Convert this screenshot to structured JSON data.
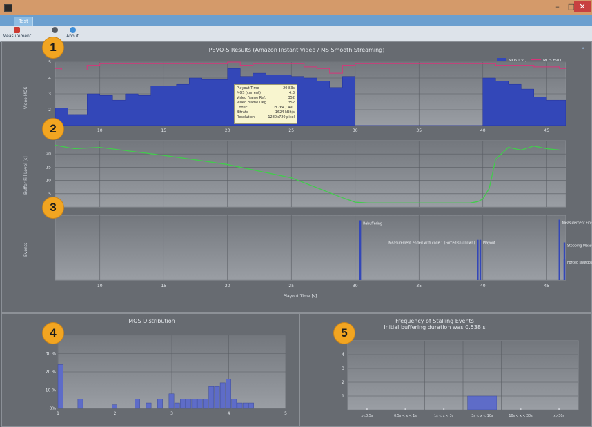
{
  "window": {
    "title": "",
    "min": "–",
    "max": "□",
    "close": "✕"
  },
  "ribbon": {
    "active_tab": "Test",
    "buttons": [
      {
        "label": "Measurement",
        "icon": "measurement-icon",
        "color": "#cc3b33"
      },
      {
        "label": "",
        "icon": "camera-icon",
        "color": "#555b63"
      },
      {
        "label": "About",
        "icon": "info-icon",
        "color": "#3f8fd8"
      }
    ]
  },
  "panel_title": "PEVQ-S Results (Amazon Instant Video / MS Smooth Streaming)",
  "badges": [
    "1",
    "2",
    "3",
    "4",
    "5"
  ],
  "colors": {
    "mos_cvq": "#3347b8",
    "mos_bvq": "#d8347a",
    "buffer": "#42cc4c",
    "event": "#3347b8",
    "hist": "#5e6cc8"
  },
  "chart_data": [
    {
      "type": "area",
      "ylabel": "Video MOS",
      "ylim": [
        1,
        5
      ],
      "yticks": [
        "2",
        "3",
        "4",
        "5"
      ],
      "xlim": [
        6.5,
        46.5
      ],
      "xticks": [
        "10",
        "15",
        "20",
        "25",
        "30",
        "35",
        "40",
        "45"
      ],
      "legend": [
        "MOS CVQ",
        "MOS BVQ"
      ],
      "legend_position": "top-right",
      "series": [
        {
          "name": "MOS CVQ",
          "x": [
            6.5,
            7,
            7.5,
            8,
            9,
            10,
            11,
            12,
            13,
            14,
            15,
            16,
            17,
            18,
            19,
            20,
            21,
            22,
            23,
            24,
            25,
            26,
            27,
            28,
            29,
            30,
            31,
            39,
            39.5,
            40,
            41,
            42,
            43,
            44,
            45,
            46
          ],
          "values": [
            2.1,
            2.1,
            1.7,
            1.7,
            3.0,
            2.9,
            2.6,
            3.0,
            2.9,
            3.5,
            3.5,
            3.6,
            4.0,
            3.9,
            3.9,
            4.6,
            4.1,
            4.3,
            4.2,
            4.2,
            4.1,
            4.0,
            3.8,
            3.4,
            4.1,
            1.0,
            1.0,
            1.0,
            1.0,
            4.0,
            3.8,
            3.6,
            3.3,
            2.8,
            2.6,
            2.6
          ]
        },
        {
          "name": "MOS BVQ",
          "x": [
            6.5,
            7,
            8,
            9,
            10,
            15,
            20,
            21,
            22,
            25,
            26,
            27,
            28,
            29,
            30,
            31,
            35,
            39,
            40,
            41,
            42,
            43,
            44,
            45,
            46
          ],
          "values": [
            4.6,
            4.5,
            4.5,
            4.8,
            4.9,
            4.9,
            5.0,
            4.8,
            4.9,
            4.9,
            4.7,
            4.6,
            4.3,
            4.8,
            4.9,
            4.9,
            4.9,
            4.9,
            4.9,
            4.8,
            4.8,
            4.8,
            4.7,
            4.7,
            4.6
          ]
        }
      ],
      "tooltip": [
        [
          "Playout Time",
          "20.83s"
        ],
        [
          "MOS (current)",
          "4.3"
        ],
        [
          "Video Frame Ref.",
          "352"
        ],
        [
          "Video Frame Deg.",
          "352"
        ],
        [
          "Codec",
          "H.264 / AVC"
        ],
        [
          "Bitrate",
          "1624 kBit/s"
        ],
        [
          "Resolution",
          "1280x720 pixel"
        ]
      ]
    },
    {
      "type": "line",
      "ylabel": "Buffer Fill Level [s]",
      "ylim": [
        0,
        25
      ],
      "yticks": [
        "5",
        "10",
        "15",
        "20"
      ],
      "xlim": [
        6.5,
        46.5
      ],
      "series": [
        {
          "name": "",
          "x": [
            6.5,
            8,
            10,
            15,
            20,
            25,
            29,
            30,
            31,
            35,
            38,
            39,
            39.6,
            40,
            40.5,
            41,
            42,
            43,
            44,
            45,
            46
          ],
          "values": [
            23.3,
            22.0,
            22.5,
            19.5,
            16.0,
            11.0,
            3.5,
            1.8,
            1.5,
            1.5,
            1.5,
            1.5,
            2.0,
            3.0,
            7.0,
            18.0,
            22.5,
            21.5,
            23.0,
            22.0,
            21.5
          ]
        }
      ]
    },
    {
      "type": "events",
      "ylabel": "Events",
      "xlabel": "Playout Time [s]",
      "xlim": [
        6.5,
        46.5
      ],
      "xticks": [
        "10",
        "15",
        "20",
        "25",
        "30",
        "35",
        "40",
        "45"
      ],
      "events": [
        {
          "x": 30.4,
          "label": "Rebuffering",
          "height": 0.92
        },
        {
          "x": 39.6,
          "label": "Measurement ended with code 1 (Forced shutdown)",
          "height": 0.62
        },
        {
          "x": 39.8,
          "label": "Playout",
          "height": 0.62
        },
        {
          "x": 46.0,
          "label": "Measurement Finished",
          "height": 0.93
        },
        {
          "x": 46.5,
          "label": "Stopping Measurement",
          "height": 0.58
        },
        {
          "x": 46.8,
          "label": "Forced shutdown",
          "height": 0.32
        }
      ]
    },
    {
      "type": "bar",
      "title": "MOS Distribution",
      "ylim": [
        0,
        40
      ],
      "yticks": [
        "0%",
        "10 %",
        "20 %",
        "30 %",
        "40 %"
      ],
      "xlim": [
        1,
        5
      ],
      "xticks": [
        "1",
        "2",
        "3",
        "4",
        "5"
      ],
      "bin_width": 0.1,
      "x": [
        1.05,
        1.4,
        2.0,
        2.4,
        2.6,
        2.8,
        3.0,
        3.1,
        3.2,
        3.3,
        3.4,
        3.5,
        3.6,
        3.7,
        3.8,
        3.9,
        4.0,
        4.1,
        4.2,
        4.3,
        4.4
      ],
      "values": [
        24,
        5,
        2,
        5,
        3,
        5,
        8,
        3,
        5,
        5,
        5,
        5,
        5,
        12,
        12,
        14,
        16,
        5,
        3,
        3,
        3
      ]
    },
    {
      "type": "bar",
      "title": "Frequency of Stalling Events",
      "subtitle": "Initial buffering duration was 0.538 s",
      "ylim": [
        0,
        5
      ],
      "yticks": [
        "1",
        "2",
        "3",
        "4"
      ],
      "categories": [
        "x<0.5s",
        "0.5s < x < 1s",
        "1s < x < 3s",
        "3s < x < 10s",
        "10s < x < 30s",
        "x>30s"
      ],
      "values": [
        0,
        0,
        0,
        1,
        0,
        0
      ]
    }
  ]
}
